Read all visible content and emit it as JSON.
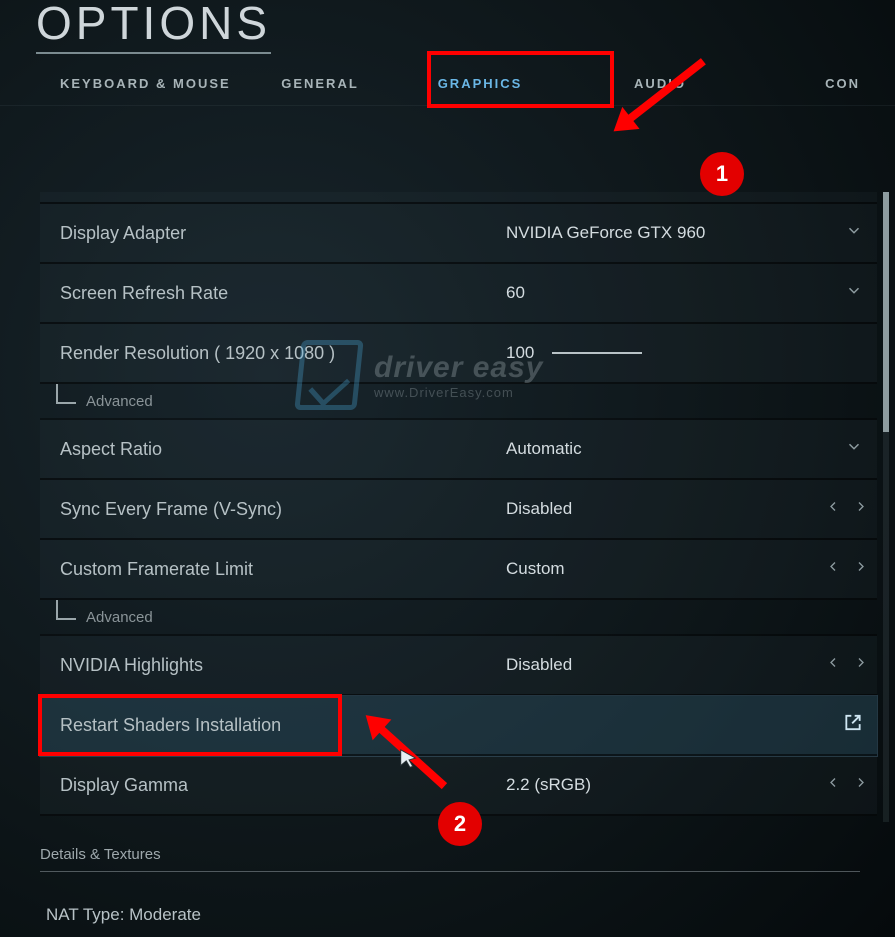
{
  "title": "OPTIONS",
  "tabs": {
    "keyboard_mouse": "KEYBOARD & MOUSE",
    "general": "GENERAL",
    "graphics": "GRAPHICS",
    "audio": "AUDIO",
    "controller_partial": "CON"
  },
  "settings": {
    "display_adapter": {
      "label": "Display Adapter",
      "value": "NVIDIA GeForce GTX 960"
    },
    "refresh_rate": {
      "label": "Screen Refresh Rate",
      "value": "60"
    },
    "render_res": {
      "label": "Render Resolution ( 1920 x 1080 )",
      "value": "100"
    },
    "advanced1": {
      "label": "Advanced"
    },
    "aspect_ratio": {
      "label": "Aspect Ratio",
      "value": "Automatic"
    },
    "vsync": {
      "label": "Sync Every Frame (V-Sync)",
      "value": "Disabled"
    },
    "framerate_limit": {
      "label": "Custom Framerate Limit",
      "value": "Custom"
    },
    "advanced2": {
      "label": "Advanced"
    },
    "nvidia_highlights": {
      "label": "NVIDIA Highlights",
      "value": "Disabled"
    },
    "restart_shaders": {
      "label": "Restart Shaders Installation"
    },
    "display_gamma": {
      "label": "Display Gamma",
      "value": "2.2 (sRGB)"
    }
  },
  "section_heading": "Details & Textures",
  "footer": {
    "nat": "NAT Type: Moderate"
  },
  "annotations": {
    "badge1": "1",
    "badge2": "2"
  },
  "watermark": {
    "line1": "driver easy",
    "line2": "www.DriverEasy.com"
  }
}
